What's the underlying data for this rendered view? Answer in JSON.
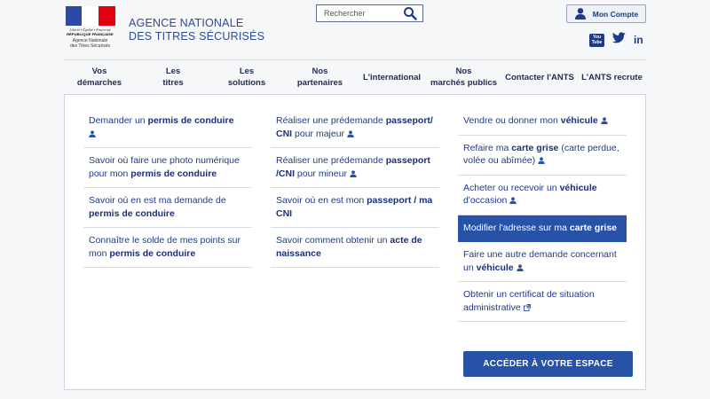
{
  "logo": {
    "motto": "Liberté • Égalité • Fraternité",
    "republic": "RÉPUBLIQUE FRANÇAISE",
    "agency_line1": "Agence Nationale",
    "agency_line2": "des Titres Sécurisés"
  },
  "header": {
    "agency_line1": "AGENCE NATIONALE",
    "agency_line2": "DES TITRES SÉCURISÉS",
    "search_placeholder": "Rechercher",
    "account_label": "Mon Compte",
    "youtube_line1": "You",
    "youtube_line2": "Tube",
    "linkedin": "in"
  },
  "nav": [
    {
      "line1": "Vos",
      "line2": "démarches"
    },
    {
      "line1": "Les",
      "line2": "titres"
    },
    {
      "line1": "Les",
      "line2": "solutions"
    },
    {
      "line1": "Nos",
      "line2": "partenaires"
    },
    {
      "line1": "L'international",
      "line2": ""
    },
    {
      "line1": "Nos",
      "line2": "marchés publics"
    },
    {
      "line1": "Contacter l'ANTS",
      "line2": ""
    },
    {
      "line1": "L'ANTS recrute",
      "line2": ""
    }
  ],
  "menu": {
    "col1": [
      {
        "pre": "Demander un ",
        "bold": "permis de conduire",
        "post": ""
      },
      {
        "pre": "Savoir où faire une photo numérique pour mon ",
        "bold": "permis de conduire",
        "post": ""
      },
      {
        "pre": "Savoir où en est ma demande de ",
        "bold": "permis de conduire",
        "post": ""
      },
      {
        "pre": "Connaître le solde de mes points sur mon ",
        "bold": "permis de conduire",
        "post": ""
      }
    ],
    "col2": [
      {
        "pre": "Réaliser une prédemande ",
        "bold": "passeport/ CNI",
        "post": " pour majeur"
      },
      {
        "pre": "Réaliser une prédemande ",
        "bold": "passeport /CNI",
        "post": " pour mineur"
      },
      {
        "pre": "Savoir où en est mon ",
        "bold": "passeport / ma CNI",
        "post": ""
      },
      {
        "pre": "Savoir comment obtenir un ",
        "bold": "acte de naissance",
        "post": ""
      }
    ],
    "col3": [
      {
        "pre": "Vendre ou donner mon ",
        "bold": "véhicule",
        "post": ""
      },
      {
        "pre": "Refaire ma ",
        "bold": "carte grise",
        "post": " (carte perdue, volée ou abîmée)"
      },
      {
        "pre": "Acheter ou recevoir un ",
        "bold": "véhicule",
        "post": " d'occasion"
      },
      {
        "pre": "Modifier l'adresse sur ma ",
        "bold": "carte grise",
        "post": ""
      },
      {
        "pre": "Faire une autre demande concernant un ",
        "bold": "véhicule",
        "post": ""
      },
      {
        "pre": "Obtenir un certificat de situation administrative",
        "bold": "",
        "post": ""
      }
    ],
    "cta": "ACCÉDER À VOTRE ESPACE"
  },
  "colors": {
    "primary": "#1f3a87",
    "active": "#2851a8"
  }
}
